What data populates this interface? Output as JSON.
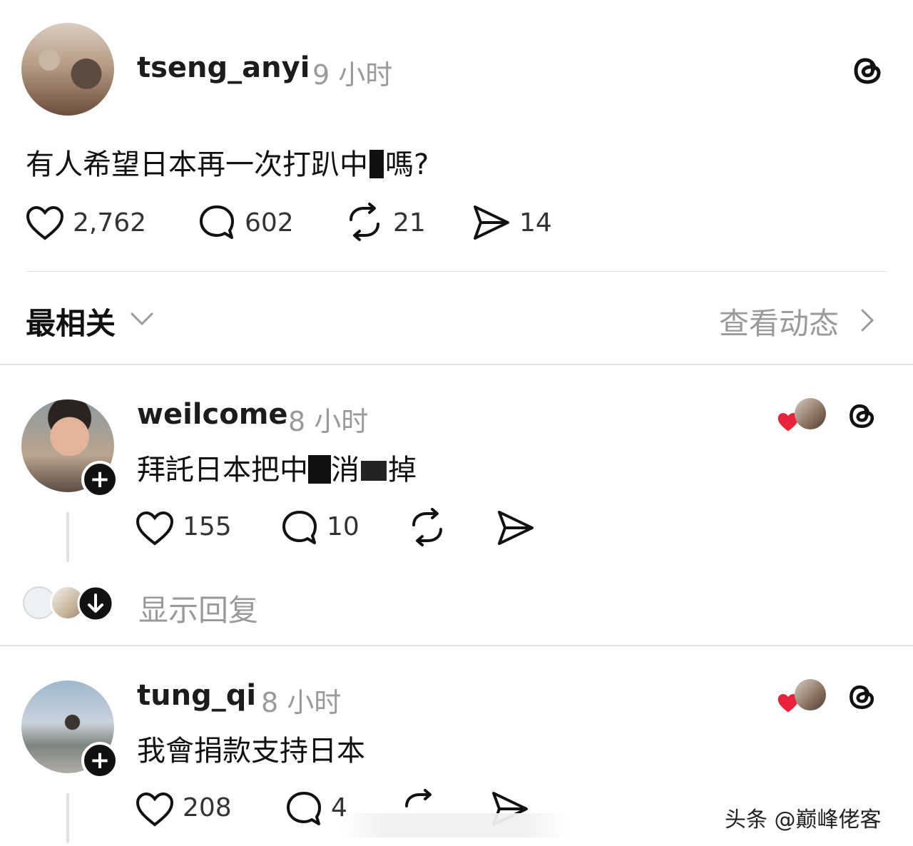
{
  "main_post": {
    "username": "tseng_anyi",
    "time": "9 小时",
    "text": "有人希望日本再一次打趴中",
    "text_tail": "嗎?",
    "likes": "2,762",
    "comments": "602",
    "reposts": "21",
    "shares": "14"
  },
  "sort_bar": {
    "label": "最相关",
    "activity_link": "查看动态"
  },
  "replies": [
    {
      "username": "weilcome",
      "time": "8 小时",
      "text_a": "拜託日本把中",
      "text_b": "消",
      "text_c": "掉",
      "likes": "155",
      "comments": "10",
      "show_replies": "显示回复"
    },
    {
      "username": "tung_qi",
      "time": "8 小时",
      "text": "我會捐款支持日本",
      "likes": "208",
      "comments": "4"
    }
  ],
  "watermark": "头条 @巅峰佬客",
  "colors": {
    "heart": "#e8233b",
    "muted": "#9a9a9a"
  }
}
